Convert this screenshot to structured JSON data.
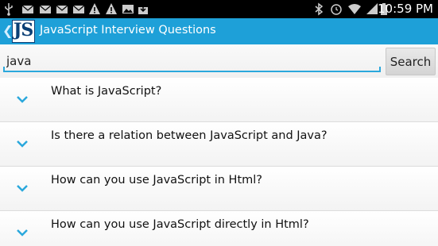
{
  "status_bar": {
    "time": "10:59 PM",
    "left_icons": [
      "usb-icon",
      "mail-icon",
      "mail-icon",
      "mail-icon",
      "mail-icon",
      "warning-icon",
      "warning-icon",
      "image-icon",
      "download-icon"
    ],
    "right_icons": [
      "bluetooth-icon",
      "alarm-icon",
      "wifi-icon",
      "signal-icon",
      "battery-icon"
    ]
  },
  "app_bar": {
    "logo_text": "JS",
    "title": "JavaScript Interview Questions"
  },
  "search": {
    "value": "java",
    "button_label": "Search"
  },
  "questions": [
    {
      "text": "What is JavaScript?"
    },
    {
      "text": "Is there a relation between JavaScript and Java?"
    },
    {
      "text": "How can you use JavaScript in Html?"
    },
    {
      "text": "How can you use JavaScript directly in Html?"
    }
  ],
  "colors": {
    "app_bar": "#1ea0d8",
    "accent": "#2aa8dc",
    "logo_ink": "#0b3f75"
  }
}
